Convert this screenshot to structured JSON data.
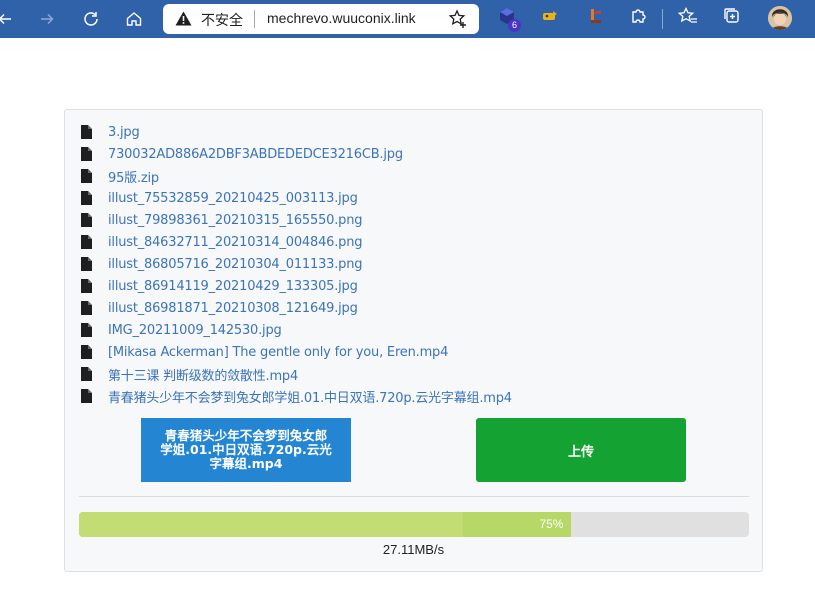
{
  "browser": {
    "security_label": "不安全",
    "url": "mechrevo.wuuconix.link",
    "extension_badge": "6",
    "colors": {
      "toolbar": "#2f62a8",
      "address_bg": "#ffffff"
    },
    "icons": [
      "back-icon",
      "forward-icon",
      "refresh-icon",
      "home-icon",
      "warning-icon",
      "add-favorite-icon",
      "extension-icon",
      "extension-icon",
      "extension-icon",
      "extensions-puzzle-icon",
      "favorites-icon",
      "collections-icon",
      "profile-avatar"
    ]
  },
  "files": [
    "3.jpg",
    "730032AD886A2DBF3ABDEDEDCE3216CB.jpg",
    "95版.zip",
    "illust_75532859_20210425_003113.jpg",
    "illust_79898361_20210315_165550.png",
    "illust_84632711_20210314_004846.png",
    "illust_86805716_20210304_011133.png",
    "illust_86914119_20210429_133305.jpg",
    "illust_86981871_20210308_121649.jpg",
    "IMG_20211009_142530.jpg",
    "[Mikasa Ackerman] The gentle only for you, Eren.mp4",
    "第十三课 判断级数的敛散性.mp4",
    "青春猪头少年不会梦到兔女郎学姐.01.中日双语.720p.云光字幕组.mp4"
  ],
  "upload": {
    "selected_file_label": "青春猪头少年不会梦到兔女郎学姐.01.中日双语.720p.云光字幕组.mp4",
    "upload_button_label": "上传",
    "progress_value": 0.735,
    "progress_text": "75%",
    "speed_text": "27.11MB/s",
    "colors": {
      "select_button": "#2486d2",
      "upload_button": "#14a232",
      "progress_fill": "#b7d867",
      "progress_track": "#e0e0e0"
    }
  }
}
